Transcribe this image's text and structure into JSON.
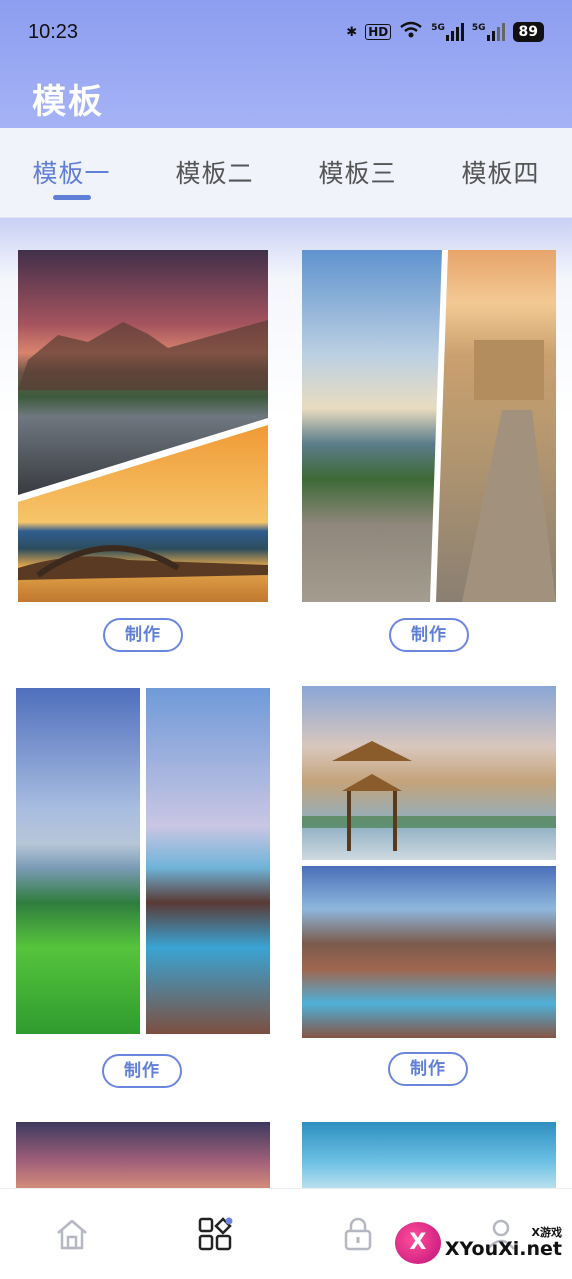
{
  "status_bar": {
    "time": "10:23",
    "hd_label": "HD",
    "net_1": "5G",
    "net_2": "5G",
    "battery": "89"
  },
  "header": {
    "title": "模板"
  },
  "tabs": [
    {
      "label": "模板一",
      "active": true
    },
    {
      "label": "模板二",
      "active": false
    },
    {
      "label": "模板三",
      "active": false
    },
    {
      "label": "模板四",
      "active": false
    }
  ],
  "templates": [
    {
      "button_label": "制作"
    },
    {
      "button_label": "制作"
    },
    {
      "button_label": "制作"
    },
    {
      "button_label": "制作"
    }
  ],
  "bottom_nav": [
    {
      "icon": "home-icon"
    },
    {
      "icon": "templates-icon",
      "active": true
    },
    {
      "icon": "lock-icon"
    },
    {
      "icon": "profile-icon"
    }
  ],
  "watermark": {
    "small": "X游戏",
    "big": "XYouXi.net",
    "badge": "X"
  },
  "colors": {
    "accent": "#5f7fd8",
    "header": "#94a4f2"
  }
}
